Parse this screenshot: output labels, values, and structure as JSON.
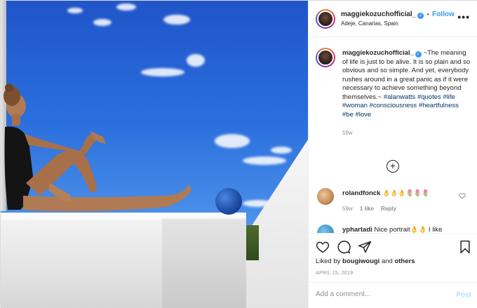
{
  "header": {
    "username": "maggiekozuchofficial_",
    "follow_label": "Follow",
    "separator": "•",
    "location": "Adeje, Canarias, Spain",
    "more_icon": "more-horizontal-icon"
  },
  "caption": {
    "username": "maggiekozuchofficial_",
    "text": "~The meaning of life is just to be alive. It is so plain and so obvious and so simple. And yet, everybody rushes around in a great panic as if it were necessary to achieve something beyond themselves.~",
    "hashtags": [
      "#alanwatts",
      "#quotes",
      "#life",
      "#woman",
      "#consciousness",
      "#heartfulness",
      "#be",
      "#love"
    ],
    "age": "59w"
  },
  "load_more_icon": "plus-circle-icon",
  "comments": [
    {
      "username": "rolandfonck",
      "text": "👌👌👌🌷🌷🌷",
      "age": "59w",
      "likes": "1 like",
      "reply": "Reply"
    },
    {
      "username": "yphartadi",
      "text": "Nice portrait👌👌 I like"
    }
  ],
  "actions": {
    "like_icon": "heart-icon",
    "comment_icon": "comment-icon",
    "share_icon": "share-icon",
    "save_icon": "bookmark-icon"
  },
  "likes": {
    "prefix": "Liked by",
    "user": "bougiwougi",
    "middle": "and",
    "others": "others"
  },
  "date": "APRIL 15, 2019",
  "add_comment": {
    "placeholder": "Add a comment...",
    "post_label": "Post"
  },
  "colors": {
    "link_blue": "#3897f0",
    "hashtag": "#003569",
    "muted": "#8e8e8e",
    "sky": "#2b6fde"
  }
}
